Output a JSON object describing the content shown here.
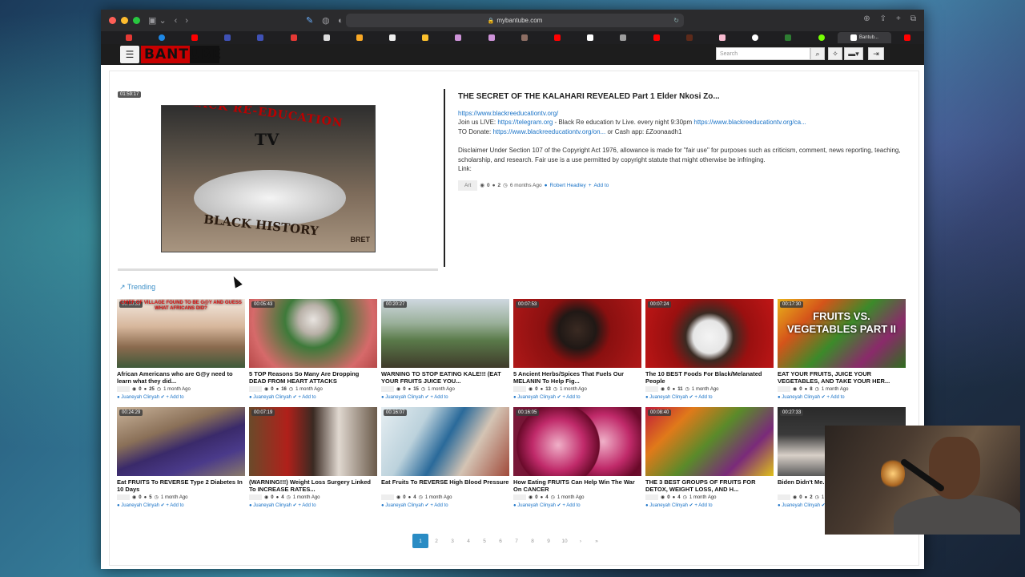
{
  "browser": {
    "url": "mybantube.com",
    "active_tab_label": "Bantub..."
  },
  "site": {
    "logo_text": "BANTUBE",
    "search_placeholder": "Search"
  },
  "featured": {
    "duration": "01:59:17",
    "title": "THE SECRET OF THE KALAHARI REVEALED Part 1 Elder Nkosi Zo...",
    "image_text": {
      "arc": "BLACK RE-EDUCATION",
      "tv": "TV",
      "bottom": "BLACK HISTORY",
      "corner": "BRET"
    },
    "link1": "https://www.blackreeducationtv.org/",
    "join_prefix": "Join us LIVE: ",
    "telegram": "https://telegram.org",
    "join_mid": " - Black Re education tv Live. every night 9:30pm ",
    "join_link": "https://www.blackreeducationtv.org/ca...",
    "donate_prefix": "TO Donate: ",
    "donate_link": "https://www.blackreeducationtv.org/on...",
    "donate_suffix": " or Cash app: £Zoonaadh1",
    "disclaimer": "Disclaimer Under Section 107 of the Copyright Act 1976, allowance is made for \"fair use\" for purposes such as criticism, comment, news reporting, teaching, scholarship, and research. Fair use is a use permitted by copyright statute that might otherwise be infringing.",
    "link_label": "Link:",
    "category": "Art",
    "views": "0",
    "likes": "2",
    "age": "6 months Ago",
    "author": "Robert Headley",
    "add_to": "Add to"
  },
  "trending_label": "Trending",
  "videos": [
    {
      "duration": "00:10:33",
      "title": "African Americans who are G@y need to learn what they did...",
      "views": "0",
      "likes": "25",
      "age": "1 month Ago",
      "author": "Juaneyah Clinyah",
      "add_to": "Add to",
      "overlay": "CHIEF OF VILLAGE FOUND TO BE G@Y AND GUESS WHAT AFRICANS DID?",
      "bg": "linear-gradient(180deg,#f3e9e0 0%,#d7b79c 40%,#8a6a4e 70%,#3f5a3a 100%)"
    },
    {
      "duration": "00:05:43",
      "title": "5 TOP Reasons So Many Are Dropping DEAD FROM HEART ATTACKS",
      "views": "0",
      "likes": "16",
      "age": "1 month Ago",
      "author": "Juaneyah Clinyah",
      "add_to": "Add to",
      "overlay": "",
      "bg": "radial-gradient(circle at 50% 30%,#e8e4e0 0%,#b9b1a8 18%,#3e7a3a 35%,#d66a6a 75%,#b54848 100%)"
    },
    {
      "duration": "00:20:27",
      "title": "WARNING TO STOP EATING KALE!!! (EAT YOUR FRUITS JUICE YOU...",
      "views": "0",
      "likes": "15",
      "age": "1 month Ago",
      "author": "Juaneyah Clinyah",
      "add_to": "Add to",
      "overlay": "",
      "bg": "linear-gradient(180deg,#cfd8e0 0%,#9ab09a 35%,#5a7a4a 60%,#3f3a2a 100%)"
    },
    {
      "duration": "00:07:53",
      "title": "5 Ancient Herbs/Spices That Fuels Our MELANIN To Help Fig...",
      "views": "0",
      "likes": "13",
      "age": "1 month Ago",
      "author": "Juaneyah Clinyah",
      "add_to": "Add to",
      "overlay": "",
      "bg": "radial-gradient(circle at 50% 45%,#3a2a22 0%,#201815 25%,#8a1010 45%,#b01818 100%)"
    },
    {
      "duration": "00:07:24",
      "title": "The 10 BEST Foods For Black/Melanated People",
      "views": "0",
      "likes": "11",
      "age": "1 month Ago",
      "author": "Juaneyah Clinyah",
      "add_to": "Add to",
      "overlay": "",
      "bg": "radial-gradient(circle at 50% 55%,#f4f4f4 0%,#e6e6e6 22%,#3a2a22 32%,#9a1010 55%,#c01616 100%)"
    },
    {
      "duration": "00:17:30",
      "title": "EAT YOUR FRUITS, JUICE YOUR VEGETABLES, AND TAKE YOUR HER...",
      "views": "0",
      "likes": "8",
      "age": "1 month Ago",
      "author": "Juaneyah Clinyah",
      "add_to": "Add to",
      "overlay": "FRUITS VS. VEGETABLES PART II",
      "bg": "linear-gradient(135deg,#e8b21a 0%,#d5541a 25%,#3c8a2a 50%,#8a2a6a 75%,#2e6e1e 100%)"
    },
    {
      "duration": "00:24:29",
      "title": "Eat FRUITS To REVERSE Type 2 Diabetes In 10 Days",
      "views": "0",
      "likes": "5",
      "age": "1 month Ago",
      "author": "Juaneyah Clinyah",
      "add_to": "Add to",
      "overlay": "",
      "bg": "linear-gradient(160deg,#c9b39a 0%,#8a7058 35%,#3a2a6a 55%,#4a3a8a 75%,#8a7a6a 100%)"
    },
    {
      "duration": "00:07:19",
      "title": "(WARNING!!!) Weight Loss Surgery Linked To INCREASE RATES...",
      "views": "0",
      "likes": "4",
      "age": "1 month Ago",
      "author": "Juaneyah Clinyah",
      "add_to": "Add to",
      "overlay": "",
      "bg": "linear-gradient(90deg,#6a4a2a 0%,#b0201a 30%,#3a2a22 50%,#e0d8d0 70%,#6a5a4a 100%)"
    },
    {
      "duration": "00:16:07",
      "title": "Eat Fruits To REVERSE High Blood Pressure",
      "views": "0",
      "likes": "4",
      "age": "1 month Ago",
      "author": "Juaneyah Clinyah",
      "add_to": "Add to",
      "overlay": "",
      "bg": "linear-gradient(120deg,#e6eef2 0%,#bcd2dc 30%,#2a6a9a 50%,#d4c4b4 70%,#a04a3a 100%)"
    },
    {
      "duration": "00:16:05",
      "title": "How Eating FRUITS Can Help Win The War On CANCER",
      "views": "0",
      "likes": "4",
      "age": "1 month Ago",
      "author": "Juaneyah Clinyah",
      "add_to": "Add to",
      "overlay": "",
      "bg": "radial-gradient(circle at 35% 55%,#f0b0c8 0%,#c02a6a 28%,#6a0a2a 45%,transparent 46%),radial-gradient(circle at 70% 50%,#f0b0c8 0%,#c02a6a 28%,#6a0a2a 45%,#7a1a3a 100%)"
    },
    {
      "duration": "00:08:40",
      "title": "THE 3 BEST GROUPS OF FRUITS FOR DETOX, WEIGHT LOSS, AND H...",
      "views": "0",
      "likes": "4",
      "age": "1 month Ago",
      "author": "Juaneyah Clinyah",
      "add_to": "Add to",
      "overlay": "",
      "bg": "linear-gradient(135deg,#c01a3a 0%,#e07a1a 25%,#5a8a2a 50%,#7a2a7a 75%,#e0c01a 100%)"
    },
    {
      "duration": "00:27:33",
      "title": "Biden Didn't Me... In SOTU Addres...",
      "views": "0",
      "likes": "2",
      "age": "1 month Ago",
      "author": "Juaneyah Clinyah",
      "add_to": "Add to",
      "overlay": "",
      "bg": "linear-gradient(180deg,#2a2a2a 0%,#3a3a3a 40%,#d8d0c8 70%,#5a5a5a 100%)"
    }
  ],
  "pagination": [
    "1",
    "2",
    "3",
    "4",
    "5",
    "6",
    "7",
    "8",
    "9",
    "10",
    "›",
    "»"
  ],
  "colors": {
    "accent": "#1a73c7",
    "brand_red": "#c90000",
    "pager_active": "#2a8cc4"
  }
}
